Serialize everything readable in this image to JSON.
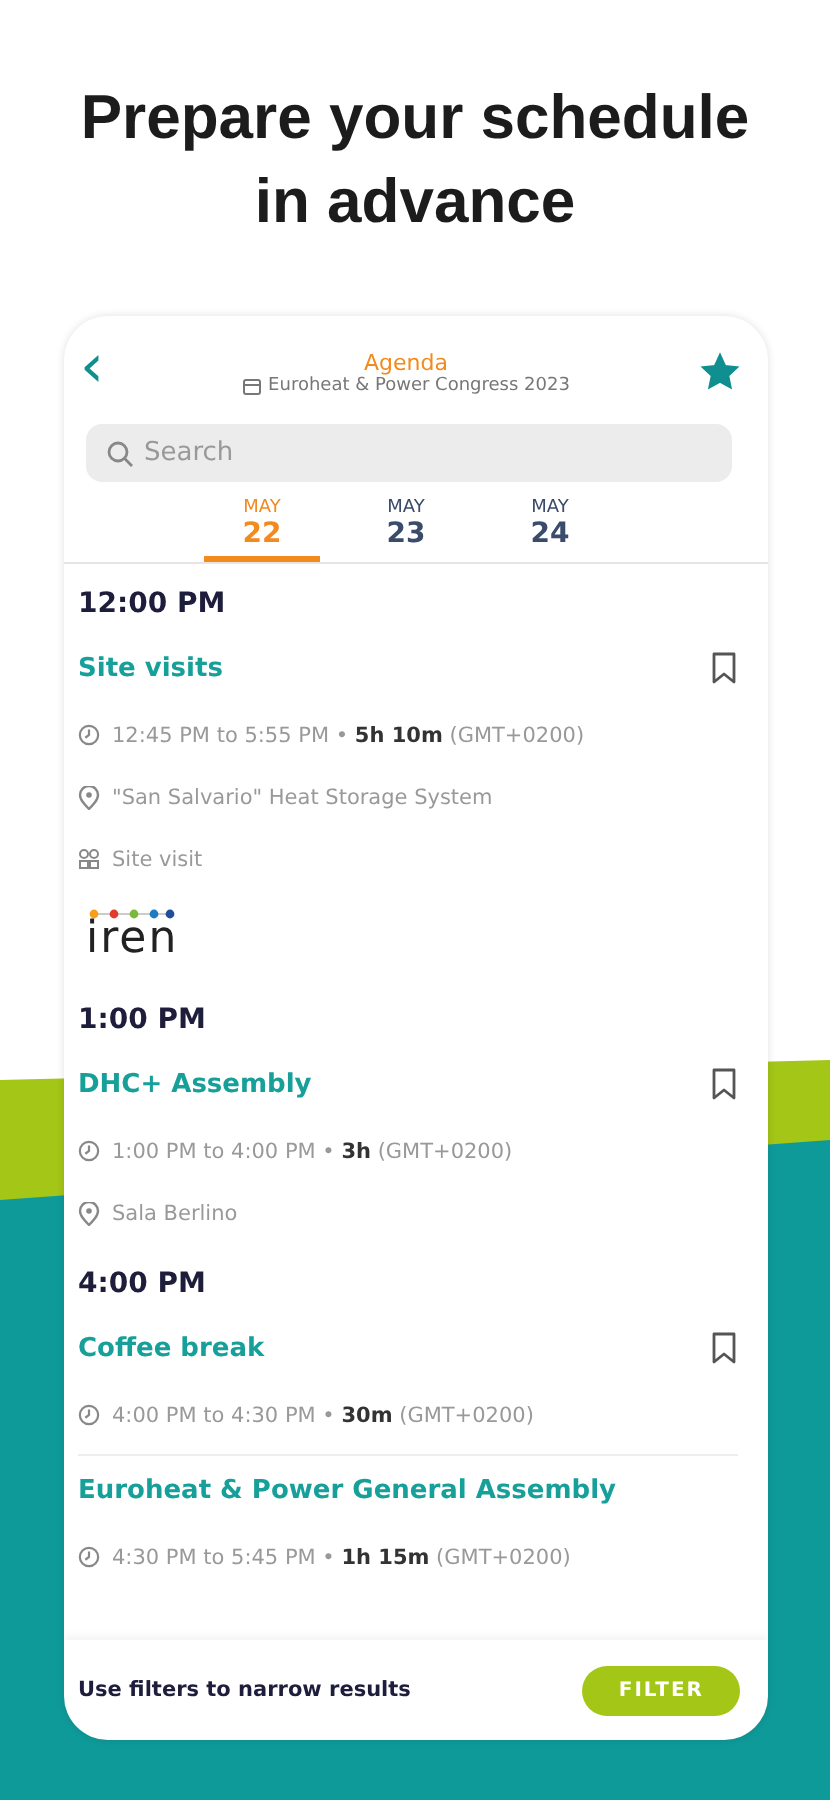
{
  "headline": "Prepare your schedule in advance",
  "header": {
    "back": "‹",
    "title": "Agenda",
    "subtitle": "Euroheat & Power Congress 2023",
    "favorite": true
  },
  "search": {
    "placeholder": "Search"
  },
  "days": [
    {
      "month": "MAY",
      "day": "22",
      "selected": true
    },
    {
      "month": "MAY",
      "day": "23",
      "selected": false
    },
    {
      "month": "MAY",
      "day": "24",
      "selected": false
    }
  ],
  "groups": [
    {
      "time": "12:00 PM",
      "events": [
        {
          "title": "Site visits",
          "bookmarked": false,
          "details": [
            {
              "kind": "time",
              "text": "12:45 PM to 5:55 PM • **5h 10m** (GMT+0200)"
            },
            {
              "kind": "location",
              "text": "\"San Salvario\" Heat Storage System"
            },
            {
              "kind": "type",
              "text": "Site visit"
            }
          ],
          "logo": "iren"
        }
      ]
    },
    {
      "time": "1:00 PM",
      "events": [
        {
          "title": "DHC+ Assembly",
          "bookmarked": false,
          "details": [
            {
              "kind": "time",
              "text": "1:00 PM to 4:00 PM • **3h** (GMT+0200)"
            },
            {
              "kind": "location",
              "text": "Sala Berlino"
            }
          ]
        }
      ]
    },
    {
      "time": "4:00 PM",
      "events": [
        {
          "title": "Coffee break",
          "bookmarked": false,
          "details": [
            {
              "kind": "time",
              "text": "4:00 PM to 4:30 PM • **30m** (GMT+0200)"
            }
          ]
        },
        {
          "title": "Euroheat & Power General Assembly",
          "details": [
            {
              "kind": "time",
              "text": "4:30 PM to 5:45 PM • **1h 15m** (GMT+0200)"
            }
          ]
        }
      ]
    }
  ],
  "footer": {
    "hint": "Use filters to narrow results",
    "button": "FILTER"
  }
}
